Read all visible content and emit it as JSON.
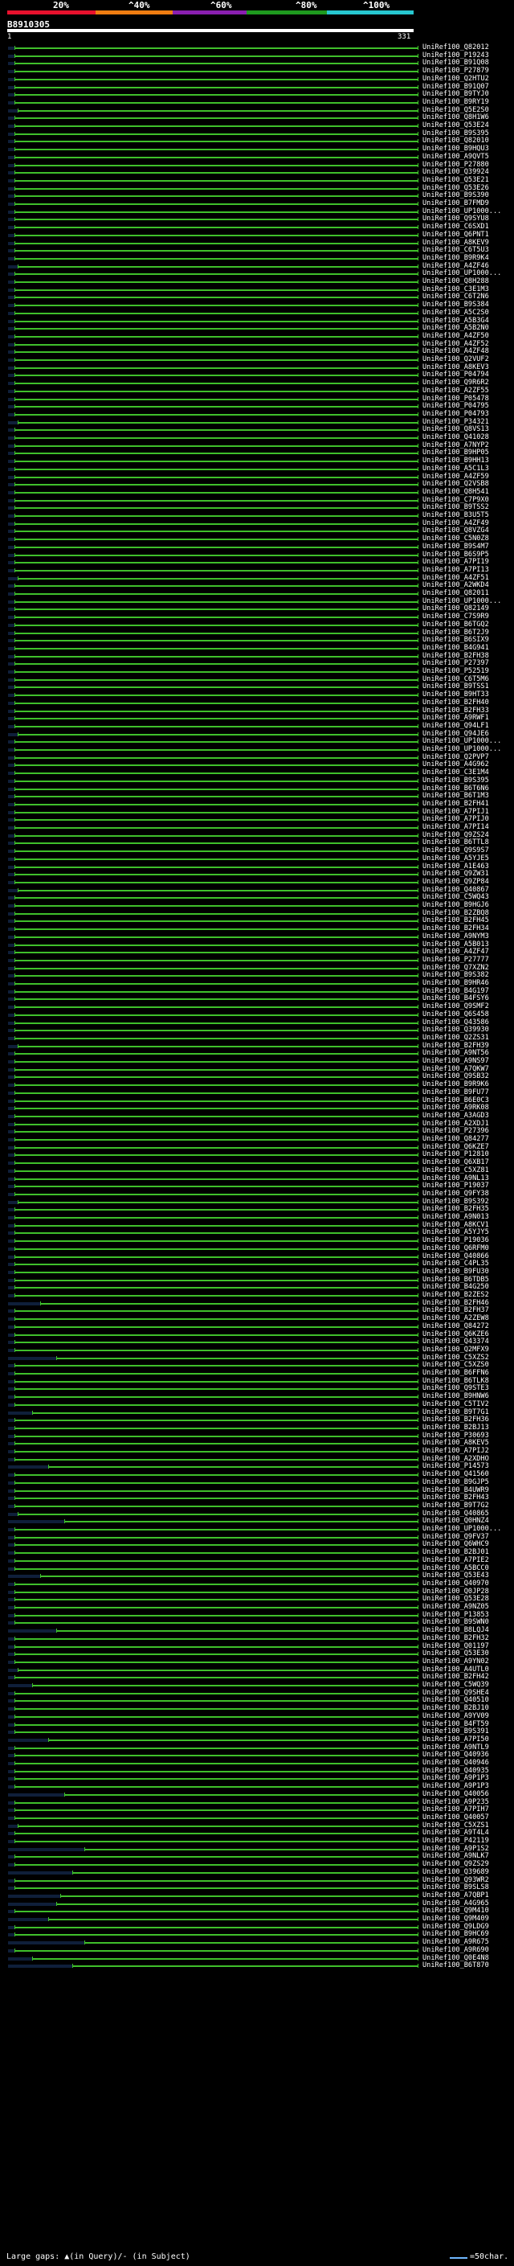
{
  "header": {
    "scale_labels": [
      "20%",
      "^40%",
      "^60%",
      "^80%",
      "^100%"
    ],
    "scale_colors": [
      "#e8112d",
      "#f07d11",
      "#8a1fb0",
      "#1e9a1e",
      "#27c7d0"
    ],
    "query_id": "B8910305",
    "tick_start": "1",
    "tick_end": "331"
  },
  "colors": {
    "hit": "#3fbf2b",
    "gap": "#0f1f3a",
    "background": "#000000"
  },
  "hits": [
    "UniRef100_Q82012",
    "UniRef100_P19243",
    "UniRef100_B91Q08",
    "UniRef100_P27879",
    "UniRef100_Q2HTU2",
    "UniRef100_B91Q07",
    "UniRef100_B9TYJ0",
    "UniRef100_B9RY19",
    "UniRef100_Q5E2S0",
    "UniRef100_Q8H1W6",
    "UniRef100_Q53E24",
    "UniRef100_B9S395",
    "UniRef100_Q82010",
    "UniRef100_B9HQU3",
    "UniRef100_A9QVT5",
    "UniRef100_P27880",
    "UniRef100_Q39924",
    "UniRef100_Q53E21",
    "UniRef100_Q53E26",
    "UniRef100_B9S390",
    "UniRef100_B7FMD9",
    "UniRef100_UP1000...",
    "UniRef100_Q9SYU8",
    "UniRef100_C6SXD1",
    "UniRef100_Q6PNT1",
    "UniRef100_A8KEV9",
    "UniRef100_C6T5U3",
    "UniRef100_B9R9K4",
    "UniRef100_A4ZF46",
    "UniRef100_UP1000...",
    "UniRef100_Q8H288",
    "UniRef100_C3E1M3",
    "UniRef100_C6T2N6",
    "UniRef100_B9S384",
    "UniRef100_A5C2S0",
    "UniRef100_A5B3G4",
    "UniRef100_A5B2N0",
    "UniRef100_A4ZF50",
    "UniRef100_A4ZF52",
    "UniRef100_A4ZF48",
    "UniRef100_Q2VUF2",
    "UniRef100_A8KEV3",
    "UniRef100_P04794",
    "UniRef100_Q9R6R2",
    "UniRef100_A2ZF55",
    "UniRef100_P05478",
    "UniRef100_P04795",
    "UniRef100_P04793",
    "UniRef100_P34321",
    "UniRef100_Q8VS13",
    "UniRef100_Q41028",
    "UniRef100_A7NYP2",
    "UniRef100_B9HP05",
    "UniRef100_B9HH13",
    "UniRef100_A5C1L3",
    "UniRef100_A4ZF59",
    "UniRef100_Q2VSB8",
    "UniRef100_Q8H541",
    "UniRef100_C7P9X0",
    "UniRef100_B9TSS2",
    "UniRef100_B3U5T5",
    "UniRef100_A4ZF49",
    "UniRef100_Q8VZG4",
    "UniRef100_C5N0Z8",
    "UniRef100_B9S4M7",
    "UniRef100_B6S9P5",
    "UniRef100_A7PI19",
    "UniRef100_A7PI13",
    "UniRef100_A4ZF51",
    "UniRef100_A2WKD4",
    "UniRef100_Q82011",
    "UniRef100_UP1000...",
    "UniRef100_Q82149",
    "UniRef100_C7S9R9",
    "UniRef100_B6TGQ2",
    "UniRef100_B6T2J9",
    "UniRef100_B6SIX9",
    "UniRef100_B4G941",
    "UniRef100_B2FH38",
    "UniRef100_P27397",
    "UniRef100_P52519",
    "UniRef100_C6T5M6",
    "UniRef100_B9TSS1",
    "UniRef100_B9HT33",
    "UniRef100_B2FH40",
    "UniRef100_B2FH33",
    "UniRef100_A9RWF1",
    "UniRef100_Q94LF1",
    "UniRef100_Q94JE6",
    "UniRef100_UP1000...",
    "UniRef100_UP1000...",
    "UniRef100_Q2PVP7",
    "UniRef100_A4G962",
    "UniRef100_C3E1M4",
    "UniRef100_B9S395",
    "UniRef100_B6T6N6",
    "UniRef100_B6T1M3",
    "UniRef100_B2FH41",
    "UniRef100_A7PIJ1",
    "UniRef100_A7PIJ0",
    "UniRef100_A7PI14",
    "UniRef100_Q9ZS24",
    "UniRef100_B6TTL8",
    "UniRef100_Q9S9S7",
    "UniRef100_A5YJE5",
    "UniRef100_A1E463",
    "UniRef100_Q9ZW31",
    "UniRef100_Q9ZP84",
    "UniRef100_Q40867",
    "UniRef100_C5WQ43",
    "UniRef100_B9HGJ6",
    "UniRef100_B2ZBQ8",
    "UniRef100_B2FH45",
    "UniRef100_B2FH34",
    "UniRef100_A9NYM3",
    "UniRef100_A5B013",
    "UniRef100_A4ZF47",
    "UniRef100_P27777",
    "UniRef100_Q7XZN2",
    "UniRef100_B9S382",
    "UniRef100_B9HR46",
    "UniRef100_B4G197",
    "UniRef100_B4FSY6",
    "UniRef100_Q9SMF2",
    "UniRef100_Q6S458",
    "UniRef100_Q43586",
    "UniRef100_Q39930",
    "UniRef100_Q2ZS31",
    "UniRef100_B2FH39",
    "UniRef100_A9NT56",
    "UniRef100_A9NS97",
    "UniRef100_A7QKW7",
    "UniRef100_Q9SB32",
    "UniRef100_B9R9K6",
    "UniRef100_B9FU77",
    "UniRef100_B6E0C3",
    "UniRef100_A9RK08",
    "UniRef100_A3AGD3",
    "UniRef100_A2XDJ1",
    "UniRef100_P27396",
    "UniRef100_Q84277",
    "UniRef100_Q6KZE7",
    "UniRef100_P12810",
    "UniRef100_Q6XB17",
    "UniRef100_C5XZ81",
    "UniRef100_A9NL13",
    "UniRef100_P19037",
    "UniRef100_Q9FY38",
    "UniRef100_B9S392",
    "UniRef100_B2FH35",
    "UniRef100_A9N013",
    "UniRef100_A8KCV1",
    "UniRef100_A5YJY5",
    "UniRef100_P19036",
    "UniRef100_Q6RFM0",
    "UniRef100_Q40866",
    "UniRef100_C4PL35",
    "UniRef100_B9FU30",
    "UniRef100_B6TDB5",
    "UniRef100_B4G250",
    "UniRef100_B2ZES2",
    "UniRef100_B2FH46",
    "UniRef100_B2FH37",
    "UniRef100_A2ZEW8",
    "UniRef100_Q84272",
    "UniRef100_Q6KZE6",
    "UniRef100_Q43374",
    "UniRef100_Q2MFX9",
    "UniRef100_C5XZS2",
    "UniRef100_C5XZS0",
    "UniRef100_B6FFN6",
    "UniRef100_B6TLK8",
    "UniRef100_Q9STE3",
    "UniRef100_B9HNW6",
    "UniRef100_C5TIV2",
    "UniRef100_B9T7G1",
    "UniRef100_B2FH36",
    "UniRef100_B2BJ13",
    "UniRef100_P30693",
    "UniRef100_A8KEV5",
    "UniRef100_A7PIJ2",
    "UniRef100_A2XDHO",
    "UniRef100_P14573",
    "UniRef100_Q41560",
    "UniRef100_B9GJP5",
    "UniRef100_B4UWR9",
    "UniRef100_B2FH43",
    "UniRef100_B9T7G2",
    "UniRef100_Q40865",
    "UniRef100_Q0HNZ4",
    "UniRef100_UP1000...",
    "UniRef100_Q9FV37",
    "UniRef100_Q6WHC9",
    "UniRef100_B2BJ01",
    "UniRef100_A7PIE2",
    "UniRef100_A5BCC0",
    "UniRef100_Q53E43",
    "UniRef100_Q40970",
    "UniRef100_Q0JP28",
    "UniRef100_Q53E28",
    "UniRef100_A9NZ05",
    "UniRef100_P13853",
    "UniRef100_B9SWN0",
    "UniRef100_B8LQJ4",
    "UniRef100_B2FH32",
    "UniRef100_Q01197",
    "UniRef100_Q53E30",
    "UniRef100_A9YN02",
    "UniRef100_A4UTL0",
    "UniRef100_B2FH42",
    "UniRef100_C5WQ39",
    "UniRef100_Q9SHE4",
    "UniRef100_Q40510",
    "UniRef100_B2BJ10",
    "UniRef100_A9YV09",
    "UniRef100_B4FT59",
    "UniRef100_B9S391",
    "UniRef100_A7PI50",
    "UniRef100_A9NTL9",
    "UniRef100_Q40936",
    "UniRef100_Q40946",
    "UniRef100_Q40935",
    "UniRef100_A9P1P3",
    "UniRef100_A9P1P3",
    "UniRef100_Q40056",
    "UniRef100_A9P235",
    "UniRef100_A7PIH7",
    "UniRef100_Q40057",
    "UniRef100_C5XZS1",
    "UniRef100_A9T4L4",
    "UniRef100_P42119",
    "UniRef100_A9P1S2",
    "UniRef100_A9NLK7",
    "UniRef100_Q9ZS29",
    "UniRef100_Q39689",
    "UniRef100_Q93WR2",
    "UniRef100_B9SLS8",
    "UniRef100_A7QBP1",
    "UniRef100_A4G965",
    "UniRef100_Q9M410",
    "UniRef100_Q9M409",
    "UniRef100_Q9LDG9",
    "UniRef100_B9HC69",
    "UniRef100_A9R675",
    "UniRef100_A9R690",
    "UniRef100_Q0E4N8",
    "UniRef100_B6T870"
  ],
  "footer": {
    "gaps_label": "Large gaps: ▲(in Query)/- (in Subject)",
    "legend_label": "=50char."
  }
}
